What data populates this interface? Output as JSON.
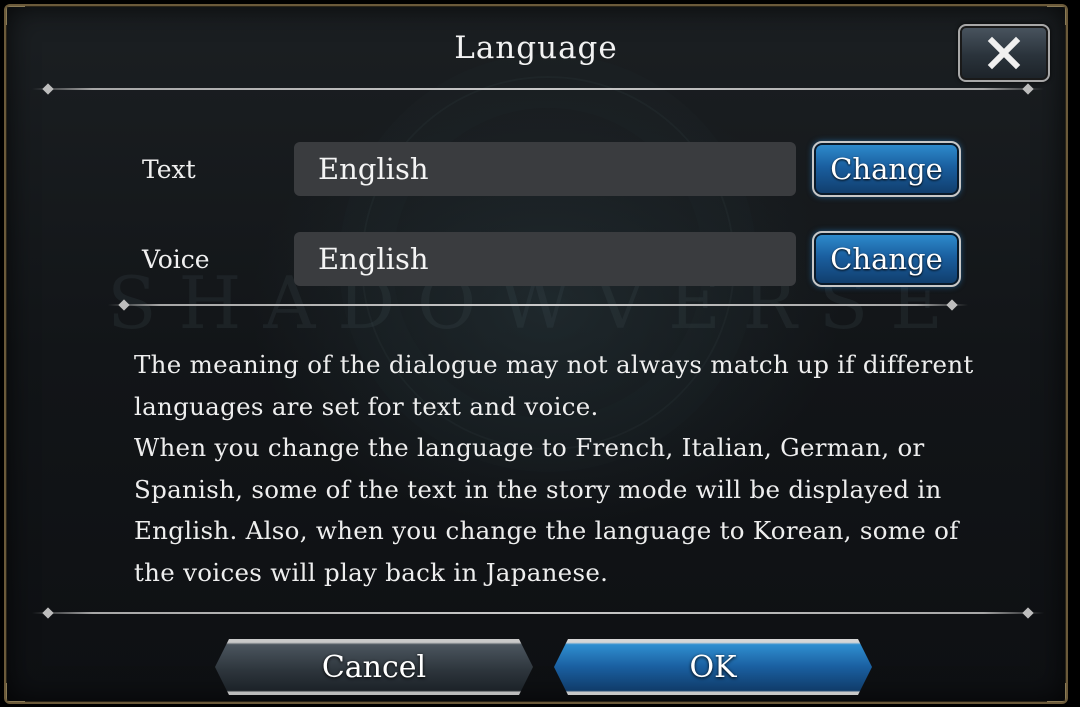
{
  "dialog": {
    "title": "Language",
    "watermark": "SHADOWVERSE",
    "close_icon": "close-icon"
  },
  "rows": [
    {
      "label": "Text",
      "value": "English",
      "button": "Change"
    },
    {
      "label": "Voice",
      "value": "English",
      "button": "Change"
    }
  ],
  "notice": {
    "para1": "The meaning of the dialogue may not always match up if different languages are set for text and voice.",
    "para2": "When you change the language to French, Italian, German, or Spanish, some of the text in the story mode will be displayed in English. Also, when you change the language to Korean, some of the voices will play back in Japanese."
  },
  "footer": {
    "cancel_label": "Cancel",
    "ok_label": "OK"
  },
  "colors": {
    "accent_blue": "#1a5fa0",
    "frame_gold": "#6b5a3a",
    "field_bg": "#3a3c3f"
  }
}
